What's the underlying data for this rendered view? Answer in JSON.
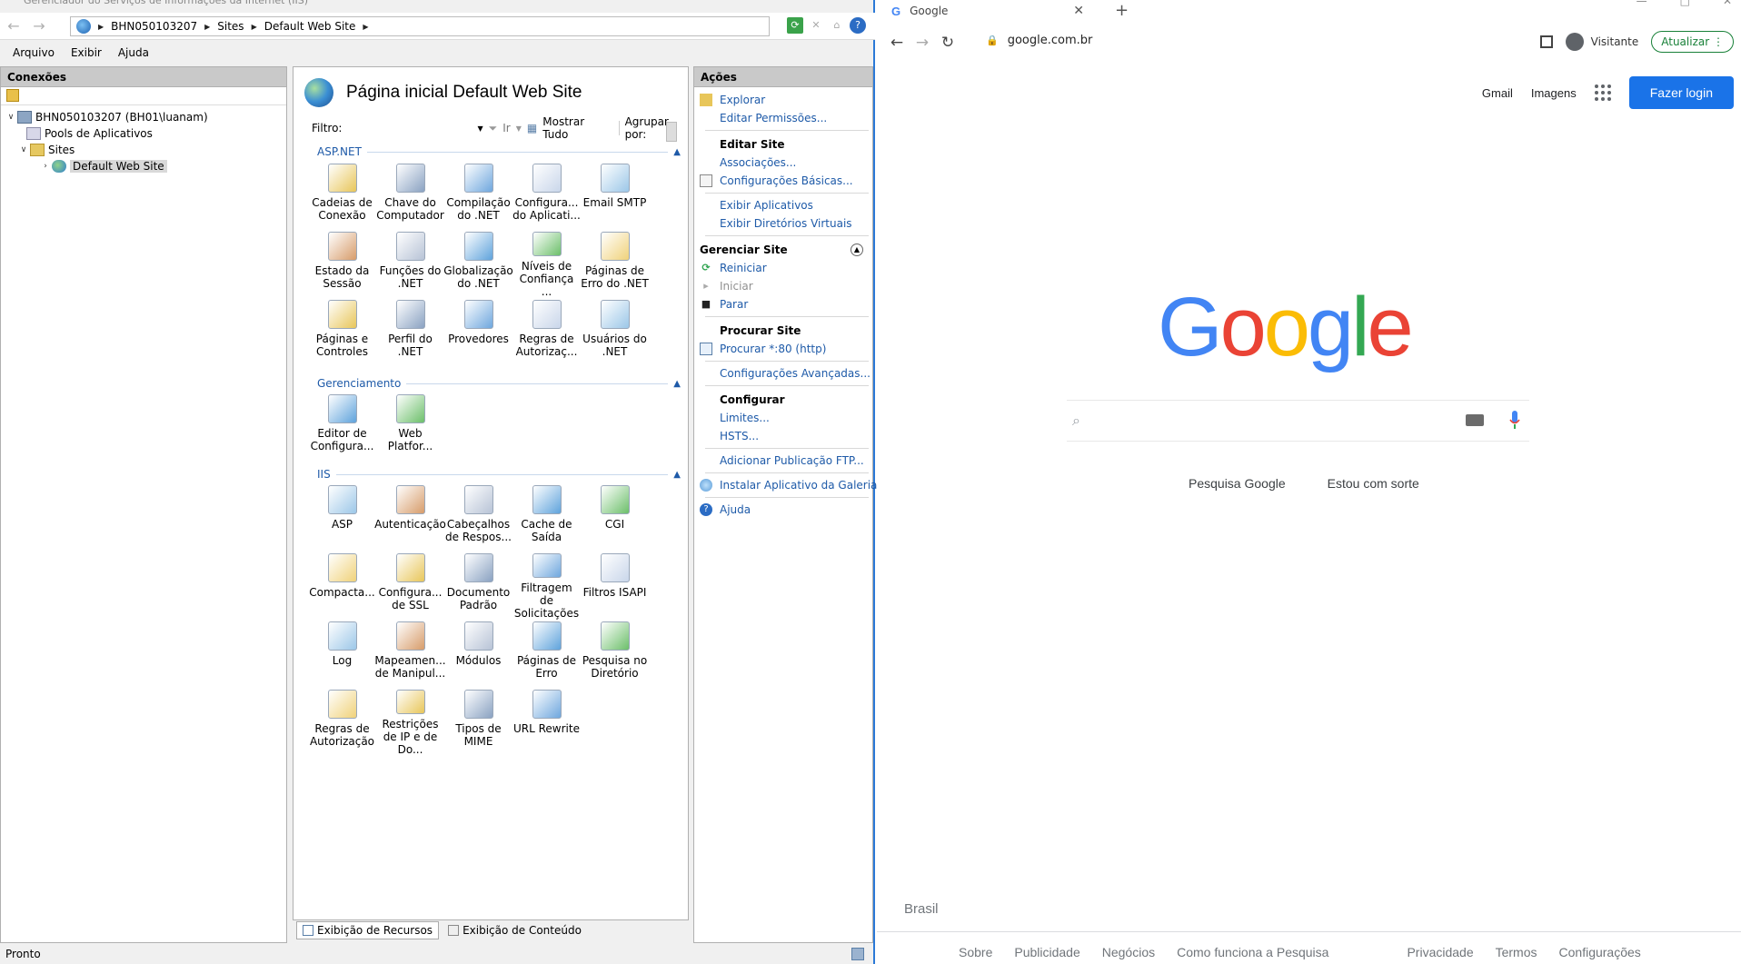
{
  "iis": {
    "title": "Gerenciador do Serviços de Informações da Internet (IIS)",
    "breadcrumb": [
      "BHN050103207",
      "Sites",
      "Default Web Site"
    ],
    "menu": [
      "Arquivo",
      "Exibir",
      "Ajuda"
    ],
    "connections": {
      "header": "Conexões",
      "tree": [
        {
          "label": "BHN050103207 (BH01\\luanam)",
          "expander": "∨"
        },
        {
          "label": "Pools de Aplicativos",
          "expander": ""
        },
        {
          "label": "Sites",
          "expander": "∨"
        },
        {
          "label": "Default Web Site",
          "expander": "›"
        }
      ]
    },
    "features": {
      "title": "Página inicial Default Web Site",
      "filter_label": "Filtro:",
      "go_label": "Ir",
      "show_all_label": "Mostrar Tudo",
      "group_by_label": "Agrupar por:",
      "groups": [
        {
          "name": "ASP.NET",
          "items": [
            {
              "label": "Cadeias de Conexão",
              "icon": "connection-strings-icon"
            },
            {
              "label": "Chave do Computador",
              "icon": "machine-key-icon"
            },
            {
              "label": "Compilação do .NET",
              "icon": "net-compilation-icon"
            },
            {
              "label": "Configura... do Aplicati...",
              "icon": "app-settings-icon"
            },
            {
              "label": "Email SMTP",
              "icon": "smtp-email-icon"
            },
            {
              "label": "Estado da Sessão",
              "icon": "session-state-icon"
            },
            {
              "label": "Funções do .NET",
              "icon": "net-roles-icon"
            },
            {
              "label": "Globalização do .NET",
              "icon": "net-globalization-icon"
            },
            {
              "label": "Níveis de Confiança ...",
              "icon": "trust-levels-icon"
            },
            {
              "label": "Páginas de Erro do .NET",
              "icon": "net-error-pages-icon"
            },
            {
              "label": "Páginas e Controles",
              "icon": "pages-controls-icon"
            },
            {
              "label": "Perfil do .NET",
              "icon": "net-profile-icon"
            },
            {
              "label": "Provedores",
              "icon": "providers-icon"
            },
            {
              "label": "Regras de Autorizaç...",
              "icon": "net-authorization-rules-icon"
            },
            {
              "label": "Usuários do .NET",
              "icon": "net-users-icon"
            }
          ]
        },
        {
          "name": "Gerenciamento",
          "items": [
            {
              "label": "Editor de Configura...",
              "icon": "configuration-editor-icon"
            },
            {
              "label": "Web Platfor...",
              "icon": "web-platform-installer-icon"
            }
          ]
        },
        {
          "name": "IIS",
          "items": [
            {
              "label": "ASP",
              "icon": "asp-icon"
            },
            {
              "label": "Autenticação",
              "icon": "authentication-icon"
            },
            {
              "label": "Cabeçalhos de Respos...",
              "icon": "response-headers-icon"
            },
            {
              "label": "Cache de Saída",
              "icon": "output-cache-icon"
            },
            {
              "label": "CGI",
              "icon": "cgi-icon"
            },
            {
              "label": "Compacta...",
              "icon": "compression-icon"
            },
            {
              "label": "Configura... de SSL",
              "icon": "ssl-settings-icon"
            },
            {
              "label": "Documento Padrão",
              "icon": "default-document-icon"
            },
            {
              "label": "Filtragem de Solicitações",
              "icon": "request-filtering-icon"
            },
            {
              "label": "Filtros ISAPI",
              "icon": "isapi-filters-icon"
            },
            {
              "label": "Log",
              "icon": "log-icon"
            },
            {
              "label": "Mapeamen... de Manipul...",
              "icon": "handler-mappings-icon"
            },
            {
              "label": "Módulos",
              "icon": "modules-icon"
            },
            {
              "label": "Páginas de Erro",
              "icon": "error-pages-icon"
            },
            {
              "label": "Pesquisa no Diretório",
              "icon": "directory-browsing-icon"
            },
            {
              "label": "Regras de Autorização",
              "icon": "authorization-rules-icon"
            },
            {
              "label": "Restrições de IP e de Do...",
              "icon": "ip-restrictions-icon"
            },
            {
              "label": "Tipos de MIME",
              "icon": "mime-types-icon"
            },
            {
              "label": "URL Rewrite",
              "icon": "url-rewrite-icon"
            }
          ]
        }
      ],
      "tabs": [
        "Exibição de Recursos",
        "Exibição de Conteúdo"
      ]
    },
    "actions": {
      "header": "Ações",
      "explore": "Explorar",
      "edit_permissions": "Editar Permissões...",
      "edit_site": "Editar Site",
      "bindings": "Associações...",
      "basic_settings": "Configurações Básicas...",
      "view_apps": "Exibir Aplicativos",
      "view_vdirs": "Exibir Diretórios Virtuais",
      "manage_site": "Gerenciar Site",
      "restart": "Reiniciar",
      "start": "Iniciar",
      "stop": "Parar",
      "browse_site": "Procurar Site",
      "browse_80": "Procurar *:80 (http)",
      "advanced_settings": "Configurações Avançadas...",
      "configure": "Configurar",
      "limits": "Limites...",
      "hsts": "HSTS...",
      "add_ftp": "Adicionar Publicação FTP...",
      "install_gallery": "Instalar Aplicativo da Galeria",
      "help": "Ajuda"
    },
    "status": "Pronto"
  },
  "chrome": {
    "tab_title": "Google",
    "url": "google.com.br",
    "profile": "Visitante",
    "update": "Atualizar",
    "header_links": [
      "Gmail",
      "Imagens"
    ],
    "signin": "Fazer login",
    "logo": [
      "G",
      "o",
      "o",
      "g",
      "l",
      "e"
    ],
    "logo_colors": [
      "#4285f4",
      "#ea4335",
      "#fbbc05",
      "#4285f4",
      "#34a853",
      "#ea4335"
    ],
    "search_button": "Pesquisa Google",
    "lucky_button": "Estou com sorte",
    "country": "Brasil",
    "footer_left": [
      "Sobre",
      "Publicidade",
      "Negócios",
      "Como funciona a Pesquisa"
    ],
    "footer_right": [
      "Privacidade",
      "Termos",
      "Configurações"
    ]
  }
}
